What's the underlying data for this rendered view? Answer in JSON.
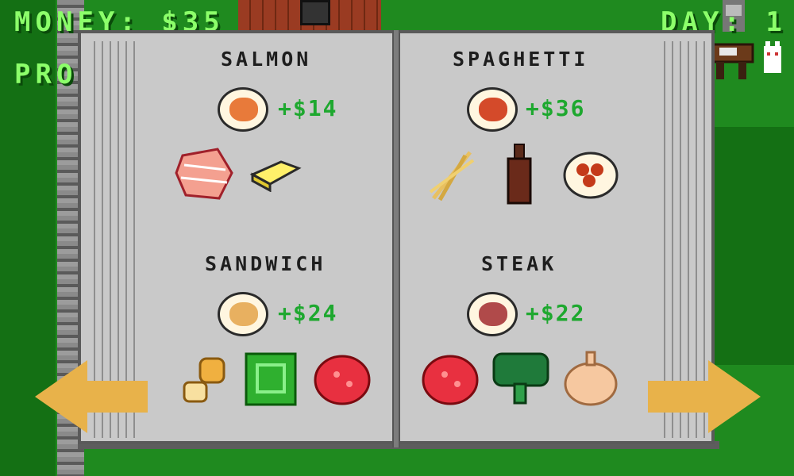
{
  "hud": {
    "money_label": "MONEY: $35",
    "progress_label": "PRO",
    "day_label": "DAY: 1"
  },
  "recipes": [
    {
      "name": "SALMON",
      "price": "+$14",
      "ingredients": [
        "salmon-steak",
        "butter"
      ]
    },
    {
      "name": "SPAGHETTI",
      "price": "+$36",
      "ingredients": [
        "wheat",
        "sauce-bottle",
        "meatballs"
      ]
    },
    {
      "name": "SANDWICH",
      "price": "+$24",
      "ingredients": [
        "bread",
        "lettuce",
        "raw-meat"
      ]
    },
    {
      "name": "STEAK",
      "price": "+$22",
      "ingredients": [
        "raw-meat",
        "broccoli",
        "garlic"
      ]
    }
  ],
  "colors": {
    "grass": "#1f8a1f",
    "hud_text": "#8cff6a",
    "price_text": "#1ea82f",
    "page": "#c9c9c9",
    "arrow": "#e8b24a"
  },
  "nav": {
    "prev_icon": "left-arrow-icon",
    "next_icon": "right-arrow-icon"
  }
}
